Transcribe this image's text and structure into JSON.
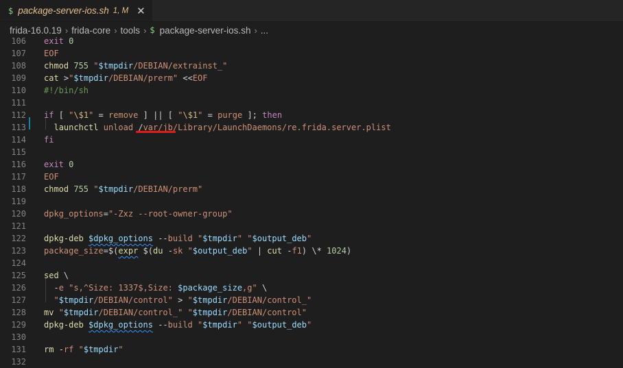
{
  "tab": {
    "icon_glyph": "$",
    "file_name": "package-server-ios.sh",
    "status": "1, M",
    "close_glyph": "✕"
  },
  "breadcrumb": {
    "items": [
      "frida-16.0.19",
      "frida-core",
      "tools"
    ],
    "file_icon_glyph": "$",
    "file": "package-server-ios.sh",
    "tail": "...",
    "sep_glyph": "›"
  },
  "editor": {
    "lines": [
      {
        "n": "106",
        "t": "exit 0"
      },
      {
        "n": "107",
        "t": "EOF"
      },
      {
        "n": "108",
        "t": "chmod 755 \"$tmpdir/DEBIAN/extrainst_\""
      },
      {
        "n": "109",
        "t": "cat >\"$tmpdir/DEBIAN/prerm\" <<EOF"
      },
      {
        "n": "110",
        "t": "#!/bin/sh"
      },
      {
        "n": "111",
        "t": ""
      },
      {
        "n": "112",
        "t": "if [ \"\\$1\" = remove ] || [ \"\\$1\" = purge ]; then"
      },
      {
        "n": "113",
        "t": "  launchctl unload /var/jb/Library/LaunchDaemons/re.frida.server.plist"
      },
      {
        "n": "114",
        "t": "fi"
      },
      {
        "n": "115",
        "t": ""
      },
      {
        "n": "116",
        "t": "exit 0"
      },
      {
        "n": "117",
        "t": "EOF"
      },
      {
        "n": "118",
        "t": "chmod 755 \"$tmpdir/DEBIAN/prerm\""
      },
      {
        "n": "119",
        "t": ""
      },
      {
        "n": "120",
        "t": "dpkg_options=\"-Zxz --root-owner-group\""
      },
      {
        "n": "121",
        "t": ""
      },
      {
        "n": "122",
        "t": "dpkg-deb $dpkg_options --build \"$tmpdir\" \"$output_deb\""
      },
      {
        "n": "123",
        "t": "package_size=$(expr $(du -sk \"$output_deb\" | cut -f1) \\* 1024)"
      },
      {
        "n": "124",
        "t": ""
      },
      {
        "n": "125",
        "t": "sed \\"
      },
      {
        "n": "126",
        "t": "  -e \"s,^Size: 1337$,Size: $package_size,g\" \\"
      },
      {
        "n": "127",
        "t": "  \"$tmpdir/DEBIAN/control\" > \"$tmpdir/DEBIAN/control_\""
      },
      {
        "n": "128",
        "t": "mv \"$tmpdir/DEBIAN/control_\" \"$tmpdir/DEBIAN/control\""
      },
      {
        "n": "129",
        "t": "dpkg-deb $dpkg_options --build \"$tmpdir\" \"$output_deb\""
      },
      {
        "n": "130",
        "t": ""
      },
      {
        "n": "131",
        "t": "rm -rf \"$tmpdir\""
      },
      {
        "n": "132",
        "t": ""
      }
    ]
  },
  "colors": {
    "background": "#1e1e1e",
    "annotation_underline": "#e51b1b",
    "modified_gutter": "#1b81a8"
  }
}
